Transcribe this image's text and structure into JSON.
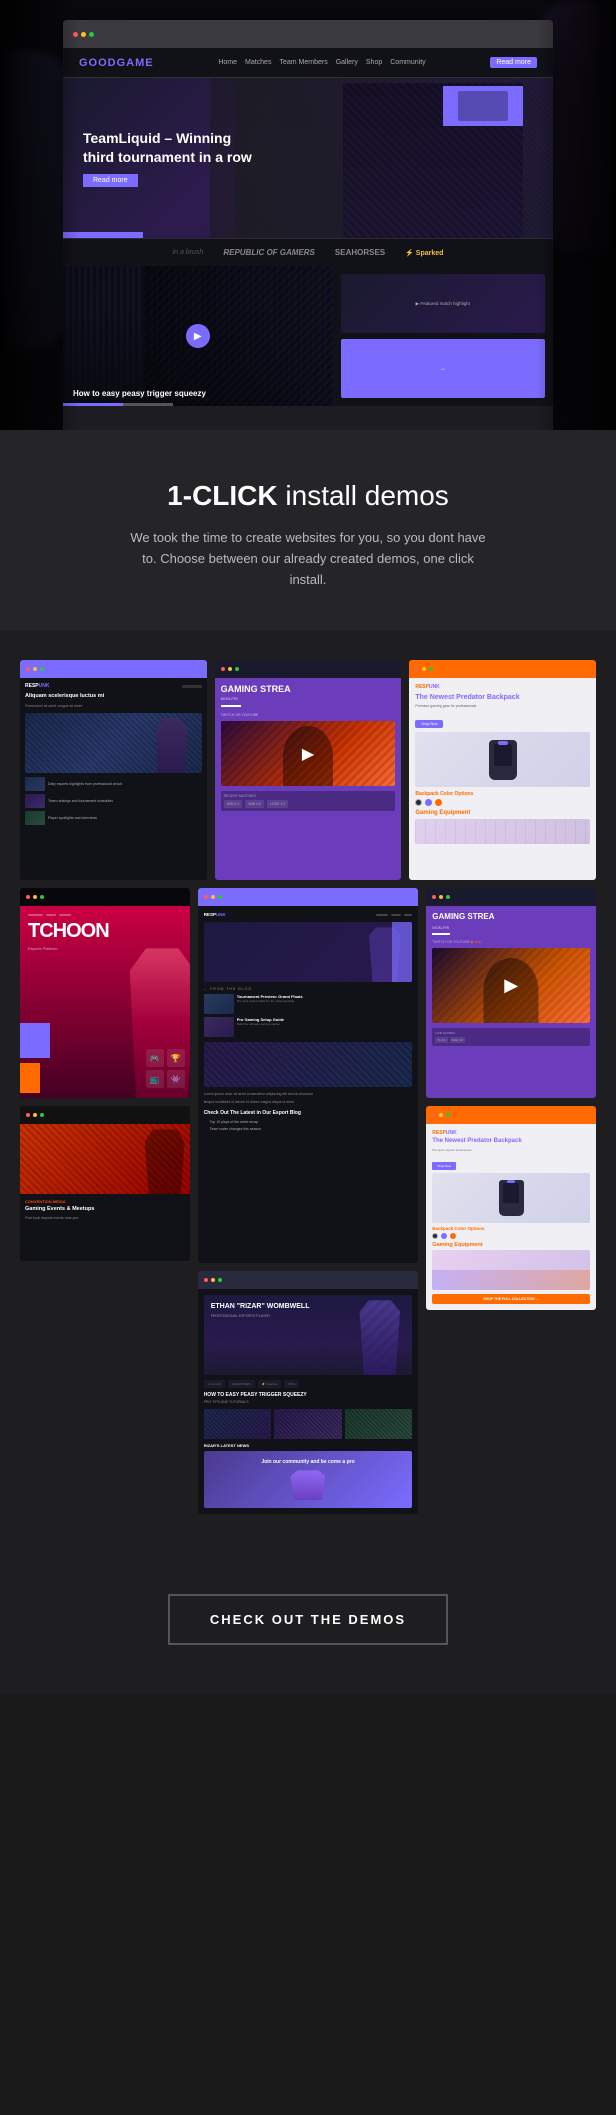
{
  "browser": {
    "traffic_lights": [
      "red",
      "yellow",
      "green"
    ],
    "logo": "GOOD",
    "logo_accent": "GAME",
    "nav_links": [
      "Home",
      "Matches",
      "Team Members",
      "Gallery",
      "Shop",
      "Community"
    ],
    "hero_title": "TeamLiquid – Winning third tournament in a row",
    "hero_cta": "Read more",
    "sponsors": [
      "in a brush",
      "REPUBLIC OF GAMERS",
      "SEAHORSES",
      "Sparked"
    ],
    "video_title": "How to easy peasy trigger squeezy"
  },
  "one_click": {
    "title_bold": "1-CLICK",
    "title_rest": " install demos",
    "description": "We took the time to create websites for you, so you dont have to. Choose between our already created demos, one click install."
  },
  "demos": {
    "d1_title": "Aliquam scelerisque luctus mi",
    "d1_sub": "Fermentum sit amet congue sit amet",
    "d2_title": "GAMING STREA",
    "d2_sub": "MON-FRI",
    "d2_twitch": "TWITCH OR YOUTUBE",
    "d3_title": "The Newest Predator Backpack",
    "d3_color_title": "Backpack Color Options",
    "d3_gaming": "Gaming Equipment",
    "dleft1_title": "TCHOON",
    "dleft2_label": "Convention Media",
    "dcenter_hero_text": "Check Out The Latest in Our Esport Blog",
    "dcenter_player_name": "ETHAN \"RIZAR\" WOMBWELL",
    "dcenter_section": "HOW TO EASY PEASY TRIGGER SQUEEZY",
    "dcenter_news": "RIZAR'S LATEST NEWS",
    "dcenter_cta": "Join our community and be come a pro"
  },
  "cta": {
    "button_label": "CHECK OUT THE DEMOS"
  }
}
